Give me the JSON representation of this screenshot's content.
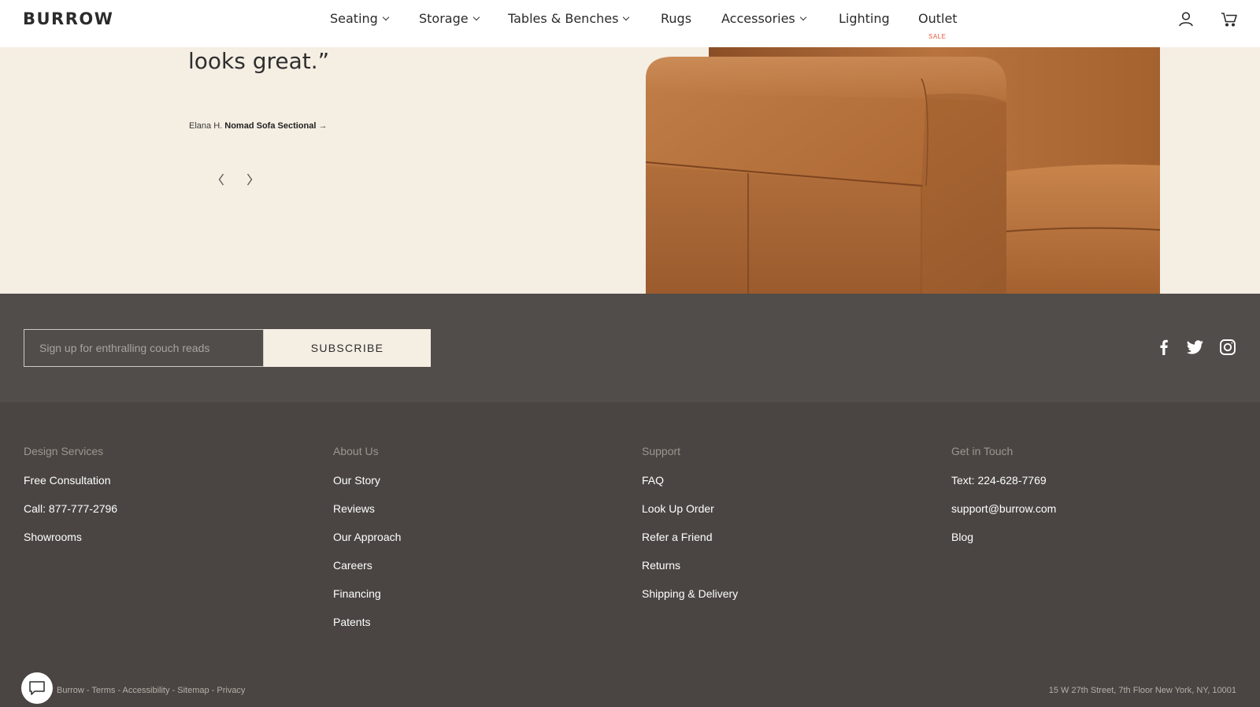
{
  "header": {
    "logo": "BURROW",
    "nav": [
      {
        "label": "Seating",
        "has_dropdown": true
      },
      {
        "label": "Storage",
        "has_dropdown": true
      },
      {
        "label": "Tables & Benches",
        "has_dropdown": true
      },
      {
        "label": "Rugs",
        "has_dropdown": false
      },
      {
        "label": "Accessories",
        "has_dropdown": true
      },
      {
        "label": "Lighting",
        "has_dropdown": false
      },
      {
        "label": "Outlet",
        "has_dropdown": false
      }
    ],
    "outlet_badge": "SALE",
    "icons": [
      "account-icon",
      "cart-icon"
    ]
  },
  "testimonial": {
    "quote_tail": "looks great.”",
    "author": "Elana H.",
    "product": "Nomad Sofa Sectional",
    "product_arrow": "→",
    "prev_icon": "chevron-left-icon",
    "next_icon": "chevron-right-icon"
  },
  "newsletter": {
    "placeholder": "Sign up for enthralling couch reads",
    "value": "",
    "button_label": "SUBSCRIBE"
  },
  "social": [
    "facebook-icon",
    "twitter-icon",
    "instagram-icon"
  ],
  "footer": {
    "columns": [
      {
        "title": "Design Services",
        "links": [
          "Free Consultation",
          "Call: 877-777-2796",
          "Showrooms"
        ]
      },
      {
        "title": "About Us",
        "links": [
          "Our Story",
          "Reviews",
          "Our Approach",
          "Careers",
          "Financing",
          "Patents"
        ]
      },
      {
        "title": "Support",
        "links": [
          "FAQ",
          "Look Up Order",
          "Refer a Friend",
          "Returns",
          "Shipping & Delivery"
        ]
      },
      {
        "title": "Get in Touch",
        "links": [
          "Text: 224-628-7769",
          "support@burrow.com",
          "Blog"
        ]
      }
    ],
    "legal": [
      "Burrow",
      "Terms",
      "Accessibility",
      "Sitemap",
      "Privacy"
    ],
    "address": "15 W 27th Street, 7th Floor New York, NY, 10001"
  },
  "colors": {
    "accent_sale": "#e2573b",
    "cream": "#f5eee3",
    "band": "#504d4b",
    "footer": "#4a4542",
    "leather": "#b06f3c"
  }
}
